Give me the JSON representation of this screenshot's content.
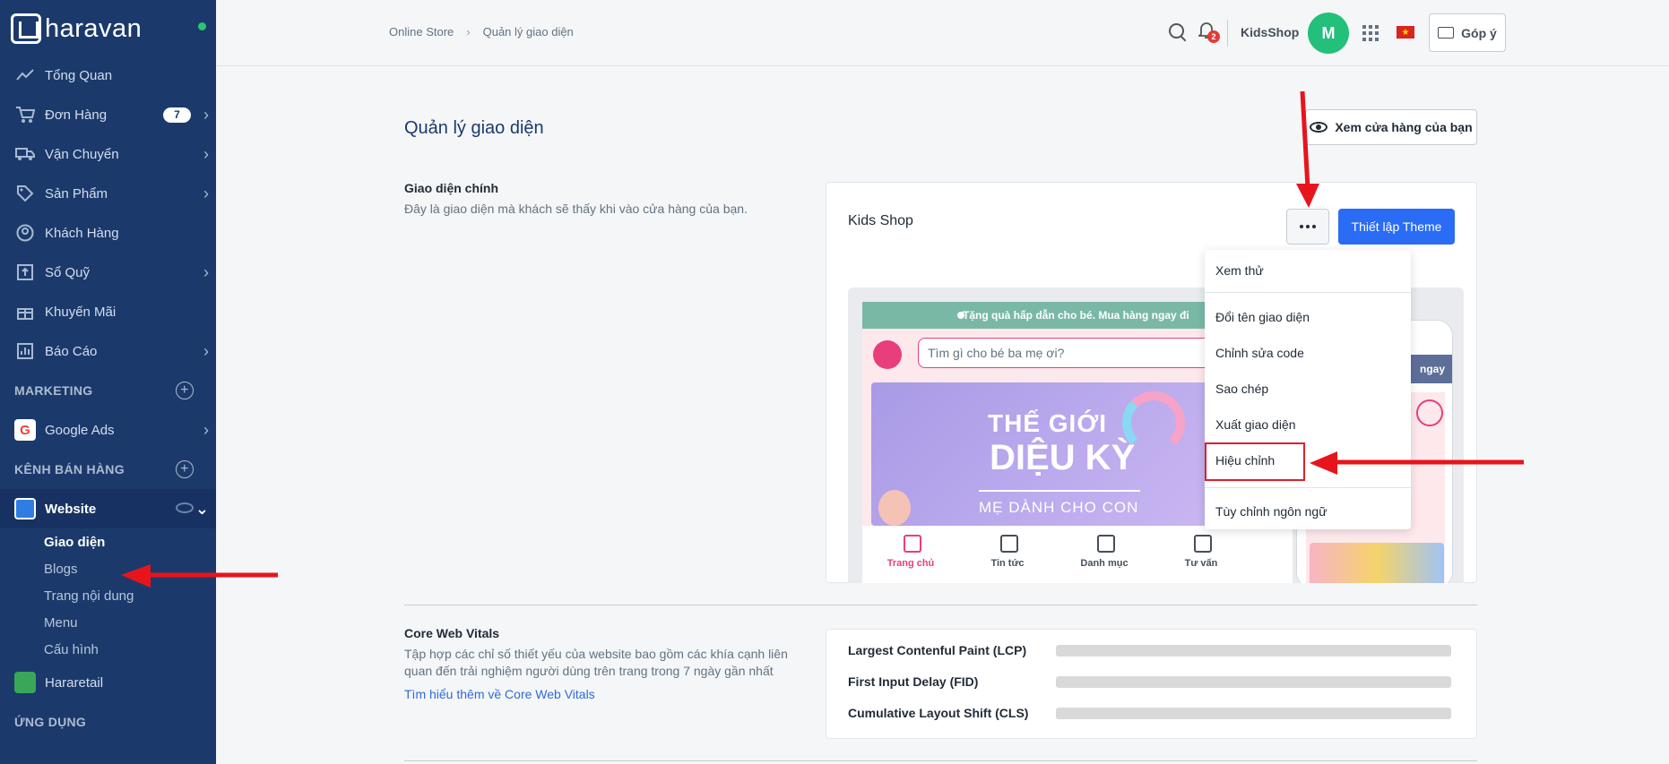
{
  "brand": {
    "name": "haravan"
  },
  "sidebar": {
    "items": [
      {
        "label": "Tổng Quan",
        "icon": "trend-icon",
        "chevron": false
      },
      {
        "label": "Đơn Hàng",
        "icon": "cart-icon",
        "chevron": true,
        "badge": "7"
      },
      {
        "label": "Vận Chuyển",
        "icon": "truck-icon",
        "chevron": true
      },
      {
        "label": "Sản Phẩm",
        "icon": "tag-icon",
        "chevron": true
      },
      {
        "label": "Khách Hàng",
        "icon": "user-icon",
        "chevron": false
      },
      {
        "label": "Sổ Quỹ",
        "icon": "cashbox-icon",
        "chevron": true
      },
      {
        "label": "Khuyến Mãi",
        "icon": "gift-icon",
        "chevron": false
      },
      {
        "label": "Báo Cáo",
        "icon": "report-icon",
        "chevron": true
      }
    ],
    "marketing_title": "MARKETING",
    "google_ads": "Google Ads",
    "sales_channel_title": "KÊNH BÁN HÀNG",
    "website": "Website",
    "website_sub": [
      "Giao diện",
      "Blogs",
      "Trang nội dung",
      "Menu",
      "Cấu hình"
    ],
    "hararetail": "Hararetail",
    "apps_title": "ỨNG DỤNG"
  },
  "topbar": {
    "breadcrumb": [
      "Online Store",
      "Quản lý giao diện"
    ],
    "notification_count": "2",
    "shop_name": "KidsShop",
    "avatar_initial": "M",
    "feedback_label": "Góp ý"
  },
  "main": {
    "page_title": "Quản lý giao diện",
    "view_store_label": "Xem cửa hàng của bạn",
    "primary_theme": {
      "title": "Giao diện chính",
      "description": "Đây là giao diện mà khách sẽ thấy khi vào cửa hàng của bạn.",
      "theme_name": "Kids Shop",
      "setup_button": "Thiết lập Theme"
    },
    "dropdown": {
      "items": [
        "Xem thử",
        "Đổi tên giao diện",
        "Chỉnh sửa code",
        "Sao chép",
        "Xuất giao diện",
        "Hiệu chỉnh",
        "Tùy chỉnh ngôn ngữ"
      ]
    },
    "preview": {
      "top_banner": "Tặng quà hấp dẫn cho bé. Mua hàng ngay đi",
      "search_placeholder": "Tìm gì cho bé ba mẹ ơi?",
      "hero_line1": "THẾ GIỚI",
      "hero_line2": "DIỆU KỲ",
      "hero_line3": "MẸ DÀNH CHO CON",
      "tabs": [
        "Trang chủ",
        "Tin tức",
        "Danh mục",
        "Tư vấn"
      ],
      "mobile_banner": "ngay"
    },
    "core_web_vitals": {
      "title": "Core Web Vitals",
      "description": "Tập hợp các chỉ số thiết yếu của website bao gồm các khía cạnh liên quan đến trải nghiệm người dùng trên trang trong 7 ngày gần nhất",
      "link": "Tìm hiểu thêm về Core Web Vitals",
      "metrics": [
        "Largest Contenful Paint (LCP)",
        "First Input Delay (FID)",
        "Cumulative Layout Shift (CLS)"
      ]
    }
  },
  "colors": {
    "sidebar_bg": "#1b3a6b",
    "primary_button": "#2a6cf5",
    "annotation_red": "#e8141c",
    "avatar_green": "#22c07a"
  }
}
